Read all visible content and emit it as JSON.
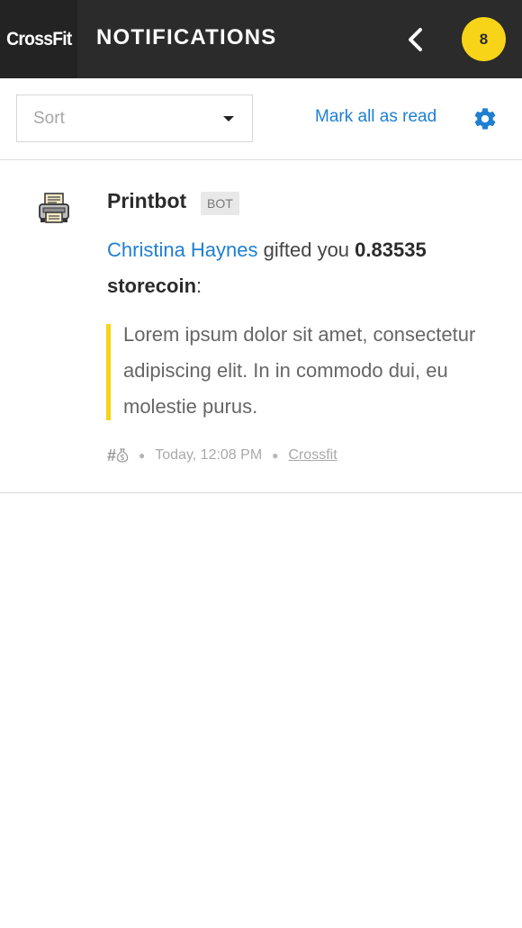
{
  "header": {
    "brand": "CrossFit",
    "title": "NOTIFICATIONS",
    "badge_count": "8",
    "accent_color": "#f7d417",
    "back_icon": "chevron-left-icon"
  },
  "toolbar": {
    "sort_placeholder": "Sort",
    "mark_all_read": "Mark all as read",
    "settings_icon": "gear-icon",
    "link_color": "#1f7fd1"
  },
  "notification": {
    "sender": "Printbot",
    "sender_tag": "BOT",
    "gifter": "Christina Haynes",
    "action_text": "gifted you",
    "amount": "0.83535 storecoin",
    "suffix": ":",
    "quote": "Lorem ipsum dolor sit amet, consectetur adipiscing elit. In in commodo dui, eu molestie purus.",
    "hash_symbol": "#",
    "timestamp": "Today, 12:08 PM",
    "community": "Crossfit"
  }
}
